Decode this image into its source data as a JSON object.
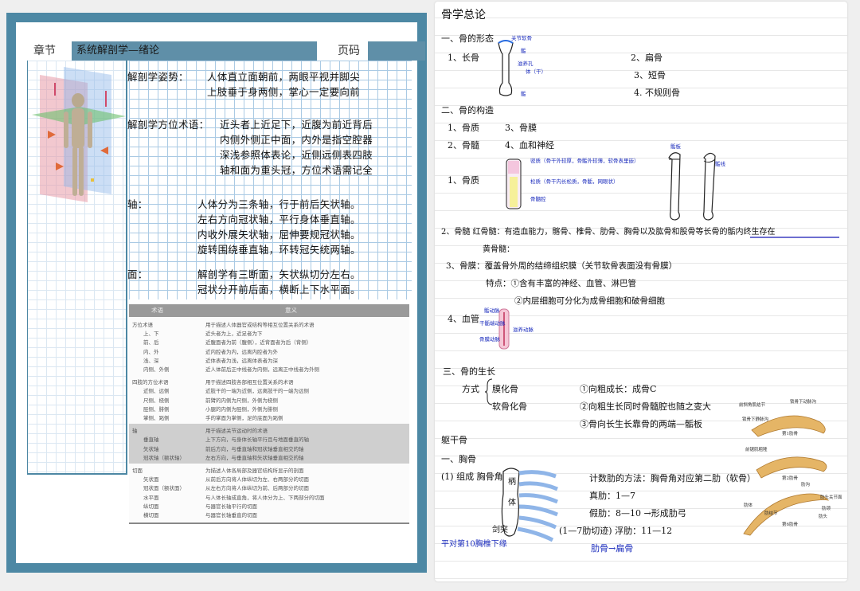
{
  "left_page": {
    "header": {
      "chapter_label": "章节",
      "chapter_title": "系统解剖学—绪论",
      "page_label": "页码"
    },
    "notes": {
      "posture_label": "解剖学姿势：",
      "posture_line1": "人体直立面朝前，两眼平视并脚尖",
      "posture_line2": "上肢垂于身两侧，掌心一定要向前",
      "terms_label": "解剖学方位术语：",
      "terms_line1": "近头者上近足下，近腹为前近背后",
      "terms_line2": "内侧外侧正中面，内外是指空腔器",
      "terms_line3": "深浅参照体表论，近侧远侧表四肢",
      "terms_line4": "轴和面为重头冠，方位术语需记全",
      "axis_label": "轴：",
      "axis_line1": "人体分为三条轴，行于前后矢状轴。",
      "axis_line2": "左右方向冠状轴，平行身体垂直轴。",
      "axis_line3": "内收外展矢状轴，屈伸要规冠状轴。",
      "axis_line4": "旋转围绕垂直轴，环转冠矢统两轴。",
      "plane_label": "面：",
      "plane_line1": "解剖学有三断面，矢状纵切分左右。",
      "plane_line2": "冠状分开前后面，横断上下水平面。"
    },
    "table": {
      "col1": "术语",
      "col2": "意义",
      "rows": [
        [
          "方位术语",
          "用于描述人体器官或结构等相互位置关系的术语"
        ],
        [
          "上、下",
          "近头者为上，近足者为下"
        ],
        [
          "前、后",
          "近腹面者为前（腹侧），近背面者为后（背侧）"
        ],
        [
          "内、外",
          "近内腔者为内，远离内腔者为外"
        ],
        [
          "浅、深",
          "近体表者为浅，远离体表者为深"
        ],
        [
          "内侧、外侧",
          "近人体前后正中线者为内侧，远离正中线者为外侧"
        ],
        [
          "四肢的方位术语",
          "用于描述四肢各部相互位置关系的术语"
        ],
        [
          "近侧、远侧",
          "近肢干的一端为近侧，远离肢干的一端为远侧"
        ],
        [
          "尺侧、桡侧",
          "前臂的内侧为尺侧，外侧为桡侧"
        ],
        [
          "胫侧、腓侧",
          "小腿的内侧为胫侧，外侧为腓侧"
        ],
        [
          "掌侧、跖侧",
          "手的掌面为掌侧，足的底面为跖侧"
        ],
        [
          "轴",
          "用于描述关节运动时的术语"
        ],
        [
          "垂直轴",
          "上下方向，与身体长轴平行且与地面垂直的轴"
        ],
        [
          "矢状轴",
          "前后方向，与垂直轴和冠状轴垂直相交的轴"
        ],
        [
          "冠状轴（额状轴）",
          "左右方向，与垂直轴和矢状轴垂直相交的轴"
        ],
        [
          "切面",
          "为描述人体各局部及器官结构所显示的剖面"
        ],
        [
          "矢状面",
          "从前后方向将人体纵切为左、右两部分的切面"
        ],
        [
          "冠状面（额状面）",
          "从左右方向将人体纵切为前、后两部分的切面"
        ],
        [
          "水平面",
          "与人体长轴成直角，将人体分为上、下两部分的切面"
        ],
        [
          "纵切面",
          "与器官长轴平行的切面"
        ],
        [
          "横切面",
          "与器官长轴垂直的切面"
        ]
      ]
    }
  },
  "right_page": {
    "title": "骨学总论",
    "s1": "一、骨的形态",
    "s1_long": "1、长骨",
    "s1_flat": "2、扁骨",
    "s1_short": "3、短骨",
    "s1_irregular": "4. 不规则骨",
    "lbl_cartilage": "关节软骨",
    "lbl_epiphysis": "骺",
    "lbl_foramen": "滋养孔",
    "lbl_shaft": "体（干）",
    "lbl_epiphysis2": "骺",
    "s2": "二、骨的构造",
    "s2_a1": "1、骨质",
    "s2_a3": "3、骨膜",
    "s2_a2": "2、骨髓",
    "s2_a4": "4、血和神经",
    "s2_b1": "1、骨质",
    "lbl_compact": "密质（骨干外较厚，骨骺外较薄，软骨表里嵌）",
    "lbl_spongy": "松质（骨干内长松质，骨骺，网眼状）",
    "lbl_marrow": "骨髓腔",
    "lbl_plate": "骺板",
    "lbl_line": "骺线",
    "s2_marrow": "2、骨髓   红骨髓：有造血能力，髂骨、椎骨、肋骨、胸骨以及肱骨和股骨等长骨的骺内终生存在",
    "s2_yellow": "黄骨髓：",
    "s2_periosteum": "3、骨膜：覆盖骨外周的结缔组织膜（关节软骨表面没有骨膜）",
    "s2_feature": "特点：①含有丰富的神经、血管、淋巴管",
    "s2_feature2": "②内层细胞可分化为成骨细胞和破骨细胞",
    "s2_vessel": "4、血管",
    "lbl_artery1": "骺动脉",
    "lbl_artery2": "干骺端动脉",
    "lbl_artery3": "滋养动脉",
    "lbl_artery4": "骨膜动脉",
    "s3": "三、骨的生长",
    "s3_mode": "方式",
    "s3_intra": "膜化骨",
    "s3_endo": "软骨化骨",
    "s3_p1": "①向粗成长：成骨C",
    "s3_p2": "②向粗生长同时骨髓腔也随之变大",
    "s3_p3": "③骨向长生长靠骨的两端—骺板",
    "s4": "躯干骨",
    "s4_sternum": "一、胸骨",
    "s4_comp": "(1) 组成 胸骨角",
    "lbl_handle": "柄",
    "lbl_body": "体",
    "lbl_xiphoid": "剑突",
    "s4_count": "计数肋的方法：胸骨角对应第二肋（软骨）",
    "s4_true": "真肋：1—7",
    "s4_false": "假肋：8—10 →形成肋弓",
    "s4_float": "(1—7肋切迹) 浮肋：11—12",
    "s4_level": "平对第10胸椎下缘",
    "s4_rib": "肋骨→扁骨",
    "rib_lbl1": "前斜角肌结节",
    "rib_lbl2": "锁骨下动脉沟",
    "rib_lbl3": "锁骨下静脉沟",
    "rib_lbl4": "第1肋骨",
    "rib_lbl5": "前锯肌粗隆",
    "rib_lbl6": "第2肋骨",
    "rib_lbl7": "肋沟",
    "rib_lbl8": "肋体",
    "rib_lbl9": "肋头关节面",
    "rib_lbl10": "肋颈",
    "rib_lbl11": "肋结节",
    "rib_lbl12": "肋头",
    "rib_lbl13": "第6肋骨"
  },
  "colors": {
    "frame": "#4d88a4",
    "header_box": "#5f8fa8",
    "grid": "#9cc1e0",
    "ink_blue": "#1c2dbd"
  }
}
